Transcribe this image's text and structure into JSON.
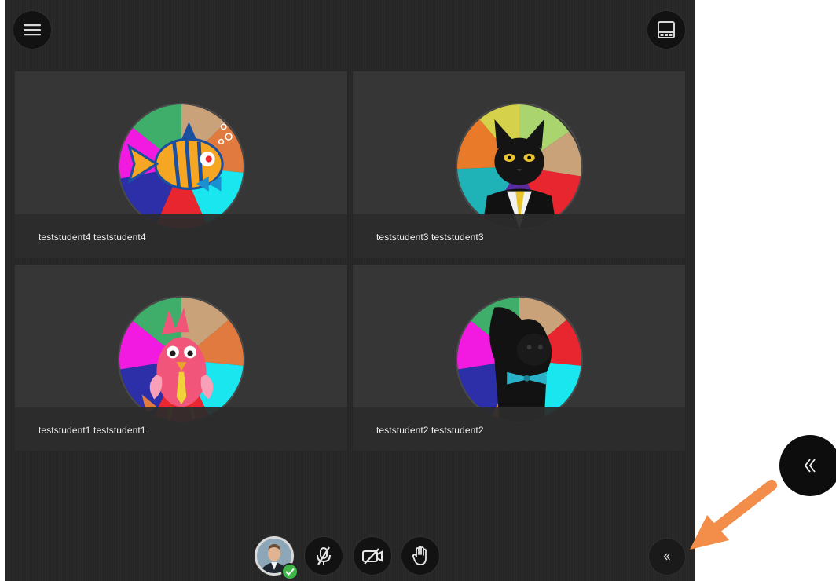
{
  "participants": [
    {
      "name": "teststudent4 teststudent4",
      "avatar": "fish-avatar"
    },
    {
      "name": "teststudent3 teststudent3",
      "avatar": "cat-avatar"
    },
    {
      "name": "teststudent1 teststudent1",
      "avatar": "bird-avatar"
    },
    {
      "name": "teststudent2 teststudent2",
      "avatar": "dog-avatar"
    }
  ],
  "toolbar": {
    "menu_icon": "hamburger-icon",
    "layout_icon": "layout-view-icon",
    "controls": [
      "user-avatar",
      "microphone-muted-icon",
      "camera-off-icon",
      "raise-hand-icon"
    ],
    "collapse_icon": "double-chevron-left-icon"
  },
  "colors": {
    "stage_bg": "#262626",
    "tile_bg": "#363636",
    "button_bg": "#121212",
    "status_green": "#3fb54a",
    "arrow": "#f28d4a"
  }
}
